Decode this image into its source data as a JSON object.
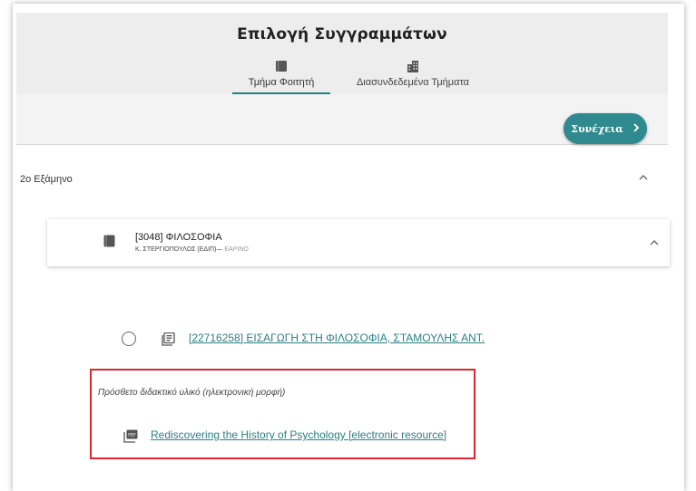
{
  "header": {
    "title": "Επιλογή Συγγραμμάτων",
    "tabs": [
      {
        "label": "Τμήμα Φοιτητή",
        "icon": "book-icon",
        "active": true
      },
      {
        "label": "Διασυνδεδεμένα Τμήματα",
        "icon": "building-icon",
        "active": false
      }
    ]
  },
  "toolbar": {
    "continue_label": "Συνέχεια"
  },
  "semester": {
    "label": "2ο Εξάμηνο"
  },
  "course": {
    "title": "[3048] ΦΙΛΟΣΟΦΙΑ",
    "instructor": "Κ. ΣΤΕΡΓΙΟΠΟΥΛΟΣ (ΕΔΙΠ)",
    "separator": "—",
    "period": "ΕΑΡΙΝΟ"
  },
  "books": [
    {
      "label": "[22716258] ΕΙΣΑΓΩΓΗ ΣΤΗ ΦΙΛΟΣΟΦΙΑ, ΣΤΑΜΟΥΛΗΣ ΑΝΤ."
    }
  ],
  "extra_material": {
    "heading": "Πρόσθετο διδακτικό υλικό (ηλεκτρονική μορφή)",
    "items": [
      {
        "label": "Rediscovering the History of Psychology [electronic resource]"
      }
    ]
  },
  "colors": {
    "accent": "#2e8a8f",
    "highlight": "#e0252b",
    "link": "#2a7f84"
  }
}
